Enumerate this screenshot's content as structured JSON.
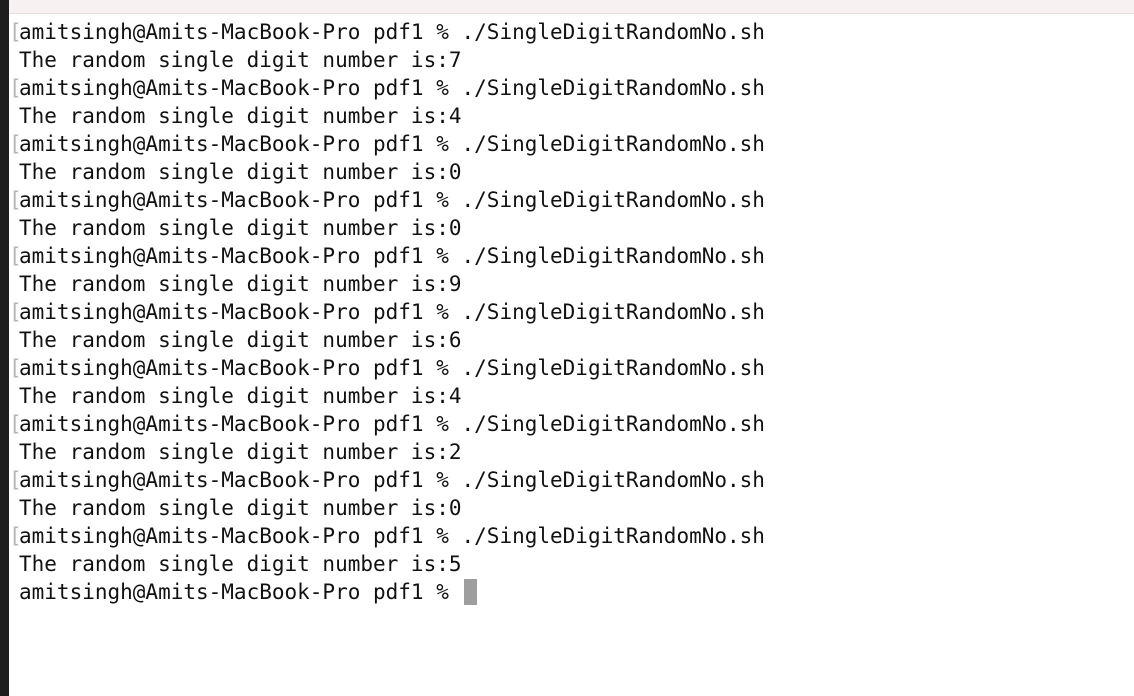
{
  "terminal": {
    "prompt": "amitsingh@Amits-MacBook-Pro pdf1 % ",
    "command": "./SingleDigitRandomNo.sh",
    "mark_symbol": "[",
    "output_prefix": "The random single digit number is:",
    "runs": [
      "7",
      "4",
      "0",
      "0",
      "9",
      "6",
      "4",
      "2",
      "0",
      "5"
    ]
  }
}
